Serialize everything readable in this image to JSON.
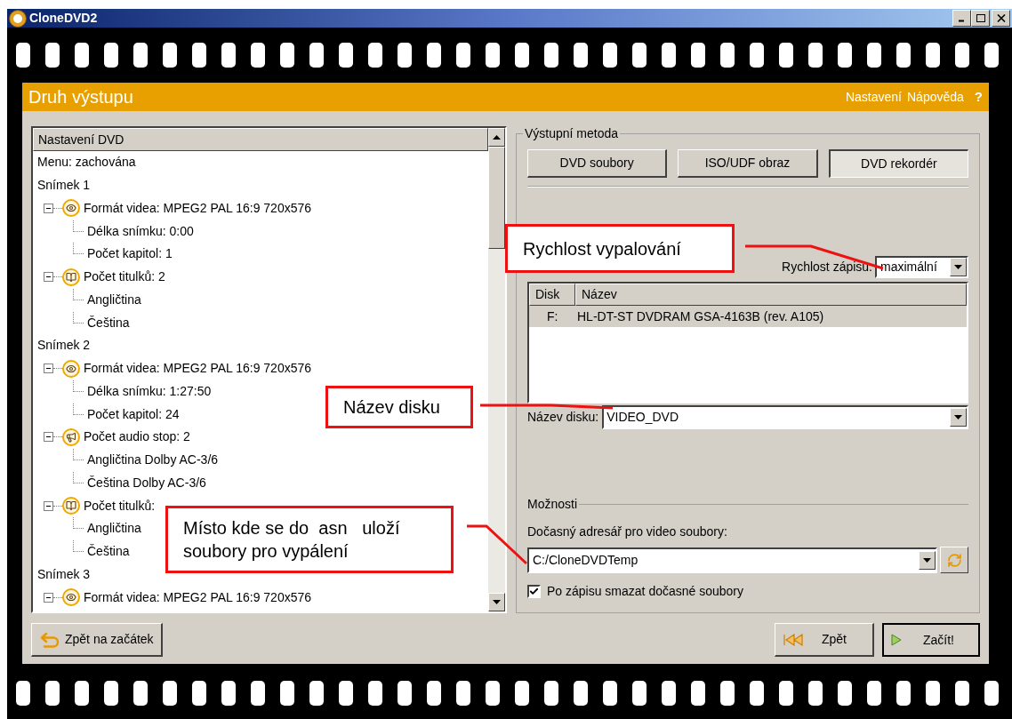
{
  "window": {
    "title": "CloneDVD2"
  },
  "header": {
    "title": "Druh výstupu",
    "links": [
      "Nastavení",
      "Nápověda"
    ],
    "help": "?"
  },
  "tree": {
    "header": "Nastavení DVD",
    "items": [
      {
        "label": "Menu: zachována"
      },
      {
        "label": "Snímek 1",
        "children": [
          {
            "label": "Formát videa: MPEG2 PAL 16:9 720x576",
            "kind": "video",
            "expanded": true,
            "children": [
              {
                "label": "Délka snímku: 0:00"
              },
              {
                "label": "Počet kapitol: 1"
              }
            ]
          },
          {
            "label": "Počet titulků: 2",
            "kind": "subtitles",
            "expanded": true,
            "children": [
              {
                "label": "Angličtina"
              },
              {
                "label": "Čeština"
              }
            ]
          }
        ]
      },
      {
        "label": "Snímek 2",
        "children": [
          {
            "label": "Formát videa: MPEG2 PAL 16:9 720x576",
            "kind": "video",
            "expanded": true,
            "children": [
              {
                "label": "Délka snímku: 1:27:50"
              },
              {
                "label": "Počet kapitol: 24"
              }
            ]
          },
          {
            "label": "Počet audio stop: 2",
            "kind": "audio",
            "expanded": true,
            "children": [
              {
                "label": "Angličtina Dolby AC-3/6"
              },
              {
                "label": "Čeština Dolby AC-3/6"
              }
            ]
          },
          {
            "label": "Počet titulků:",
            "kind": "subtitles",
            "expanded": true,
            "children": [
              {
                "label": "Angličtina"
              },
              {
                "label": "Čeština"
              }
            ]
          }
        ]
      },
      {
        "label": "Snímek 3",
        "children": [
          {
            "label": "Formát videa: MPEG2 PAL 16:9 720x576",
            "kind": "video",
            "expanded": true
          }
        ]
      }
    ]
  },
  "output_method": {
    "title": "Výstupní metoda",
    "buttons": [
      {
        "label": "DVD soubory",
        "selected": false
      },
      {
        "label": "ISO/UDF obraz",
        "selected": false
      },
      {
        "label": "DVD rekordér",
        "selected": true
      }
    ]
  },
  "speed": {
    "label": "Rychlost zápisu:",
    "value": "maximální"
  },
  "recorders": {
    "columns": [
      "Disk",
      "Název"
    ],
    "rows": [
      {
        "disk": "F:",
        "name": "HL-DT-ST DVDRAM GSA-4163B (rev. A105)",
        "selected": true
      }
    ]
  },
  "disc_name": {
    "label": "Název disku:",
    "value": "VIDEO_DVD"
  },
  "options": {
    "title": "Možnosti",
    "temp_label": "Dočasný adresář pro video soubory:",
    "temp_value": "C:/CloneDVDTemp",
    "delete_temp": {
      "label": "Po zápisu smazat dočasné soubory",
      "checked": true
    }
  },
  "footer": {
    "home": "Zpět na začátek",
    "back": "Zpět",
    "start": "Začít!"
  },
  "callouts": [
    {
      "lines": [
        "Rychlost vypalování"
      ]
    },
    {
      "lines": [
        "Název disku"
      ]
    },
    {
      "lines": [
        "Místo kde se do  asn   uloží",
        "soubory pro vypálení"
      ]
    }
  ]
}
